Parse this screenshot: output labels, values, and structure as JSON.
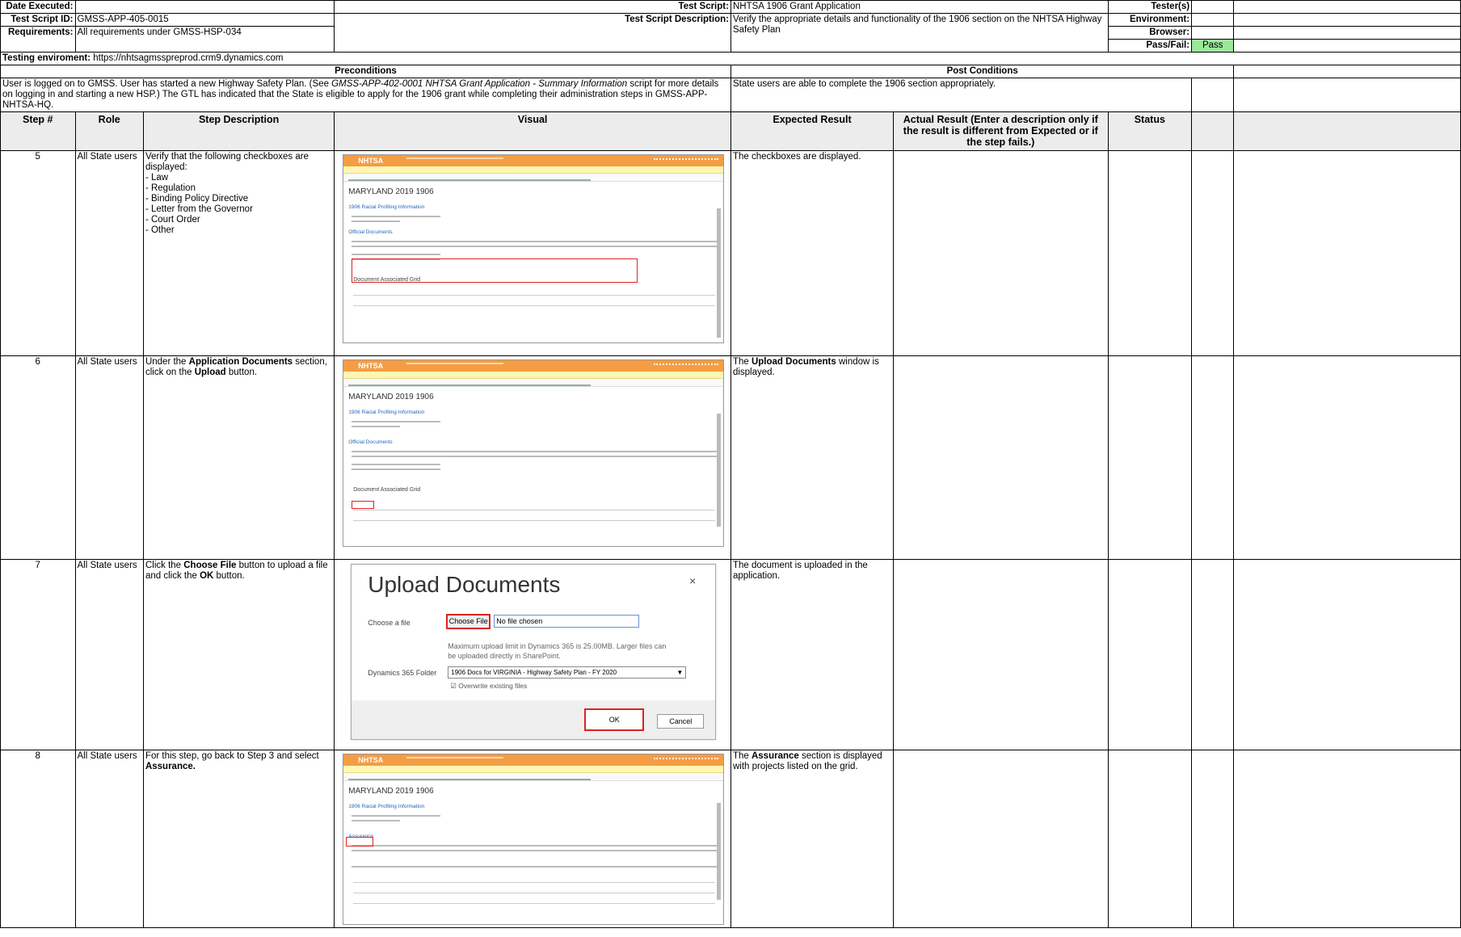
{
  "header": {
    "date_executed_label": "Date Executed:",
    "date_executed_value": "",
    "test_script_id_label": "Test Script ID:",
    "test_script_id_value": "GMSS-APP-405-0015",
    "requirements_label": "Requirements:",
    "requirements_value": "All requirements under GMSS-HSP-034",
    "test_script_label": "Test Script:",
    "test_script_value": "NHTSA 1906 Grant Application",
    "test_script_desc_label": "Test Script Description:",
    "test_script_desc_value": "Verify the appropriate details and functionality of the 1906 section on the NHTSA Highway Safety Plan",
    "testers_label": "Tester(s)",
    "environment_label": "Environment:",
    "browser_label": "Browser:",
    "pass_fail_label": "Pass/Fail:",
    "pass_fail_value": "Pass",
    "testing_env_label": "Testing enviroment:",
    "testing_env_value": "https://nhtsagmsspreprod.crm9.dynamics.com"
  },
  "conditions": {
    "pre_title": "Preconditions",
    "post_title": "Post Conditions",
    "pre_text_1": "User is logged on to GMSS. User has started a new Highway Safety Plan.  (See ",
    "pre_text_ital": "GMSS-APP-402-0001 NHTSA Grant Application - Summary Information",
    "pre_text_2": " script for more details on logging in and starting a new HSP.) The GTL has indicated that the State is eligible to apply for the 1906 grant while completing their administration steps in GMSS-APP-NHTSA-HQ.",
    "post_text": "State users are able to complete the 1906 section appropriately."
  },
  "columns": {
    "step": "Step #",
    "role": "Role",
    "description": "Step Description",
    "visual": "Visual",
    "expected": "Expected Result",
    "actual": "Actual Result (Enter a description only if the result is different from Expected or if the step fails.)",
    "status": "Status"
  },
  "steps": [
    {
      "num": "5",
      "role": "All State users",
      "desc_lines": [
        "Verify that the following checkboxes are displayed:",
        "- Law",
        "- Regulation",
        "- Binding Policy Directive",
        "- Letter from the Governor",
        "- Court Order",
        "- Other"
      ],
      "expected": "The checkboxes are displayed.",
      "shot": {
        "brand": "NHTSA",
        "title": "MARYLAND 2019 1906",
        "section_1": "1906 Racial Profiling Information",
        "section_2": "Official Documents",
        "grid": "Document Associated Grid"
      }
    },
    {
      "num": "6",
      "role": "All State users",
      "desc_pre": "Under the ",
      "desc_b1": "Application Documents",
      "desc_mid": " section, click on the ",
      "desc_b2": "Upload",
      "desc_post": " button.",
      "exp_pre": "The ",
      "exp_b": "Upload Documents",
      "exp_post": " window is displayed.",
      "shot": {
        "brand": "NHTSA",
        "title": "MARYLAND 2019 1906",
        "section_1": "1906 Racial Profiling Information",
        "section_2": "Official Documents",
        "grid": "Document Associated Grid"
      }
    },
    {
      "num": "7",
      "role": "All State users",
      "desc_pre": "Click the ",
      "desc_b1": "Choose File",
      "desc_mid": " button to upload a file and click the ",
      "desc_b2": "OK",
      "desc_post": " button.",
      "expected": "The document is uploaded in the application.",
      "dialog": {
        "title": "Upload Documents",
        "close": "×",
        "choose_label": "Choose a file",
        "choose_button": "Choose File",
        "file_status": "No file chosen",
        "note": "Maximum upload limit in Dynamics 365 is 25.00MB. Larger files can be uploaded directly in SharePoint.",
        "folder_label": "Dynamics 365 Folder",
        "folder_value": "1906 Docs for VIRGINIA - Highway Safety Plan - FY 2020",
        "overwrite": "Overwrite existing files",
        "ok": "OK",
        "cancel": "Cancel"
      }
    },
    {
      "num": "8",
      "role": "All State users",
      "desc_pre": "For this step, go back to Step 3 and select ",
      "desc_b1": "Assurance.",
      "exp_pre": "The ",
      "exp_b": "Assurance",
      "exp_post": " section is displayed with projects listed on the grid.",
      "shot": {
        "brand": "NHTSA",
        "title": "MARYLAND 2019 1906",
        "section_1": "1906 Racial Profiling Information",
        "section_2": "Assurance"
      }
    }
  ]
}
